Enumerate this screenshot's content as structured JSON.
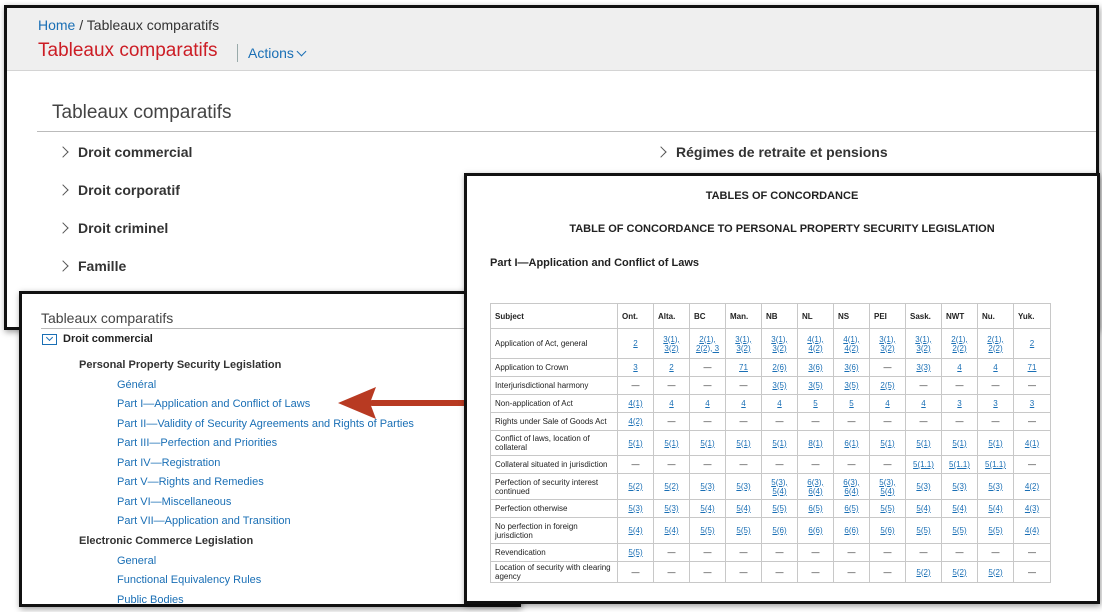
{
  "main": {
    "breadcrumb_home": "Home",
    "breadcrumb_sep": "/",
    "breadcrumb_current": "Tableaux comparatifs",
    "title": "Tableaux comparatifs",
    "actions_label": "Actions",
    "section_title": "Tableaux comparatifs",
    "categories_left": [
      "Droit commercial",
      "Droit corporatif",
      "Droit criminel",
      "Famille"
    ],
    "categories_right": [
      "Régimes de retraite et pensions"
    ]
  },
  "tree": {
    "title": "Tableaux comparatifs",
    "root": "Droit commercial",
    "groups": [
      {
        "label": "Personal Property Security Legislation",
        "links": [
          "Général",
          "Part I—Application and Conflict of Laws",
          "Part II—Validity of Security Agreements and Rights of Parties",
          "Part III—Perfection and Priorities",
          "Part IV—Registration",
          "Part V—Rights and Remedies",
          "Part VI—Miscellaneous",
          "Part VII—Application and Transition"
        ]
      },
      {
        "label": "Electronic Commerce Legislation",
        "links": [
          "General",
          "Functional Equivalency Rules",
          "Public Bodies"
        ]
      }
    ]
  },
  "doc": {
    "heading": "TABLES OF CONCORDANCE",
    "subheading": "TABLE OF CONCORDANCE TO PERSONAL PROPERTY SECURITY LEGISLATION",
    "part_title": "Part I—Application and Conflict of Laws",
    "columns": [
      "Subject",
      "Ont.",
      "Alta.",
      "BC",
      "Man.",
      "NB",
      "NL",
      "NS",
      "PEI",
      "Sask.",
      "NWT",
      "Nu.",
      "Yuk."
    ],
    "rows": [
      [
        "Application of Act, general",
        "2",
        "3(1), 3(2)",
        "2(1), 2(2), 3",
        "3(1), 3(2)",
        "3(1), 3(2)",
        "4(1), 4(2)",
        "4(1), 4(2)",
        "3(1), 3(2)",
        "3(1), 3(2)",
        "2(1), 2(2)",
        "2(1), 2(2)",
        "2"
      ],
      [
        "Application to Crown",
        "3",
        "2",
        "—",
        "71",
        "2(6)",
        "3(6)",
        "3(6)",
        "—",
        "3(3)",
        "4",
        "4",
        "71"
      ],
      [
        "Interjurisdictional harmony",
        "—",
        "—",
        "—",
        "—",
        "3(5)",
        "3(5)",
        "3(5)",
        "2(5)",
        "—",
        "—",
        "—",
        "—"
      ],
      [
        "Non-application of Act",
        "4(1)",
        "4",
        "4",
        "4",
        "4",
        "5",
        "5",
        "4",
        "4",
        "3",
        "3",
        "3"
      ],
      [
        "Rights under Sale of Goods Act",
        "4(2)",
        "—",
        "—",
        "—",
        "—",
        "—",
        "—",
        "—",
        "—",
        "—",
        "—",
        "—"
      ],
      [
        "Conflict of laws, location of collateral",
        "5(1)",
        "5(1)",
        "5(1)",
        "5(1)",
        "5(1)",
        "8(1)",
        "6(1)",
        "5(1)",
        "5(1)",
        "5(1)",
        "5(1)",
        "4(1)"
      ],
      [
        "Collateral situated in jurisdiction",
        "—",
        "—",
        "—",
        "—",
        "—",
        "—",
        "—",
        "—",
        "5(1.1)",
        "5(1.1)",
        "5(1.1)",
        "—"
      ],
      [
        "Perfection of security interest continued",
        "5(2)",
        "5(2)",
        "5(3)",
        "5(3)",
        "5(3), 5(4)",
        "6(3), 6(4)",
        "6(3), 6(4)",
        "5(3), 5(4)",
        "5(3)",
        "5(3)",
        "5(3)",
        "4(2)"
      ],
      [
        "Perfection otherwise",
        "5(3)",
        "5(3)",
        "5(4)",
        "5(4)",
        "5(5)",
        "6(5)",
        "6(5)",
        "5(5)",
        "5(4)",
        "5(4)",
        "5(4)",
        "4(3)"
      ],
      [
        "No perfection in foreign jurisdiction",
        "5(4)",
        "5(4)",
        "5(5)",
        "5(5)",
        "5(6)",
        "6(6)",
        "6(6)",
        "5(6)",
        "5(5)",
        "5(5)",
        "5(5)",
        "4(4)"
      ],
      [
        "Revendication",
        "5(5)",
        "—",
        "—",
        "—",
        "—",
        "—",
        "—",
        "—",
        "—",
        "—",
        "—",
        "—"
      ],
      [
        "Location of security with clearing agency",
        "—",
        "—",
        "—",
        "—",
        "—",
        "—",
        "—",
        "—",
        "5(2)",
        "5(2)",
        "5(2)",
        "—"
      ]
    ]
  }
}
